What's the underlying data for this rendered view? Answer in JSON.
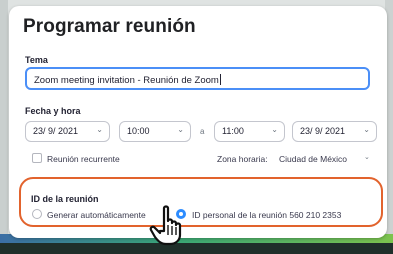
{
  "dialog": {
    "title": "Programar reunión",
    "topic_label": "Tema",
    "topic_value": "Zoom meeting invitation - Reunión de Zoom",
    "datetime_label": "Fecha y hora",
    "start_date": "23/ 9/ 2021",
    "start_time": "10:00",
    "separator": "a",
    "end_time": "11:00",
    "end_date": "23/ 9/ 2021",
    "recurring_label": "Reunión recurrente",
    "timezone_label": "Zona horaria:",
    "timezone_value": "Ciudad de México",
    "meeting_id_label": "ID de la reunión",
    "auto_generate_label": "Generar automáticamente",
    "personal_id_label": "ID personal de la reunión 560 210 2353",
    "meeting_id_selected": "personal"
  },
  "colors": {
    "accent": "#2d8cff",
    "input_focus": "#4b8ff7",
    "highlight": "#e2632d"
  }
}
